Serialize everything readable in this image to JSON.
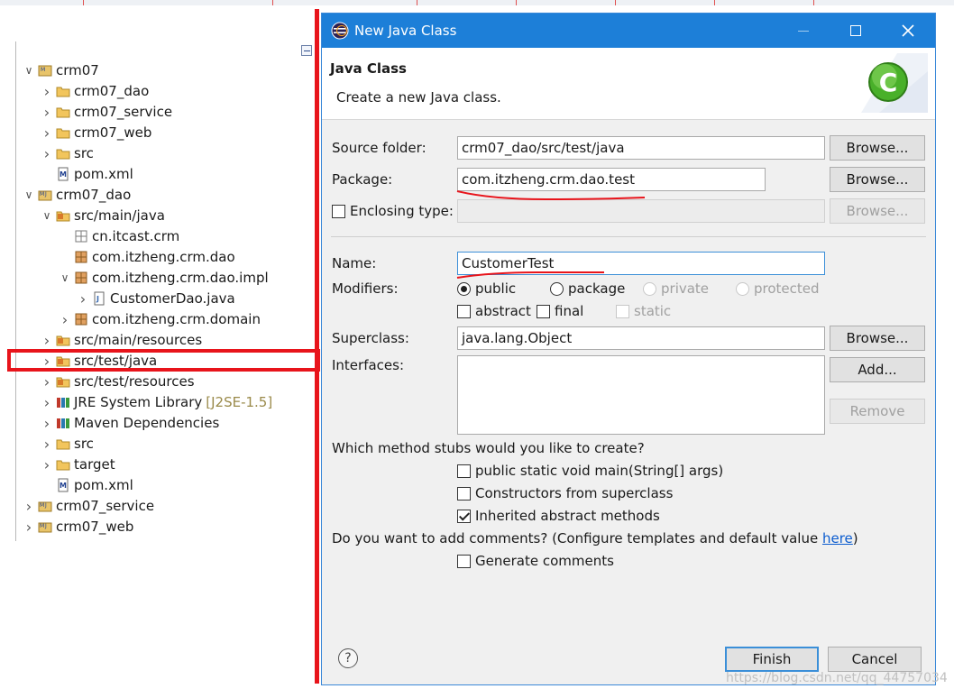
{
  "colors": {
    "titlebar": "#1d7fd8",
    "annotation_red": "#e8141b",
    "focus_blue": "#3b8fd8",
    "link": "#0b5ccf",
    "decoration": "#9a8a4a"
  },
  "explorer": {
    "collapse_icon": "collapse-all-icon",
    "tree": [
      {
        "label": "crm07",
        "icon": "maven-project-icon",
        "level": 0,
        "expanded": true
      },
      {
        "label": "crm07_dao",
        "icon": "folder-icon",
        "level": 1,
        "expanded": false
      },
      {
        "label": "crm07_service",
        "icon": "folder-icon",
        "level": 1,
        "expanded": false
      },
      {
        "label": "crm07_web",
        "icon": "folder-icon",
        "level": 1,
        "expanded": false
      },
      {
        "label": "src",
        "icon": "folder-icon",
        "level": 1,
        "expanded": false
      },
      {
        "label": "pom.xml",
        "icon": "maven-file-icon",
        "level": 1,
        "leaf": true
      },
      {
        "label": "crm07_dao",
        "icon": "maven-java-project-icon",
        "level": 0,
        "expanded": true
      },
      {
        "label": "src/main/java",
        "icon": "source-folder-icon",
        "level": 1,
        "expanded": true
      },
      {
        "label": "cn.itcast.crm",
        "icon": "empty-package-icon",
        "level": 2,
        "leaf": true
      },
      {
        "label": "com.itzheng.crm.dao",
        "icon": "package-icon",
        "level": 2,
        "leaf": true
      },
      {
        "label": "com.itzheng.crm.dao.impl",
        "icon": "package-icon",
        "level": 2,
        "expanded": true
      },
      {
        "label": "CustomerDao.java",
        "icon": "java-file-icon",
        "level": 3,
        "expanded": false
      },
      {
        "label": "com.itzheng.crm.domain",
        "icon": "package-icon",
        "level": 2,
        "expanded": false
      },
      {
        "label": "src/main/resources",
        "icon": "source-folder-icon",
        "level": 1,
        "expanded": false
      },
      {
        "label": "src/test/java",
        "icon": "source-folder-icon",
        "level": 1,
        "expanded": false,
        "selected": true
      },
      {
        "label": "src/test/resources",
        "icon": "source-folder-icon",
        "level": 1,
        "expanded": false
      },
      {
        "label": "JRE System Library",
        "decoration": "[J2SE-1.5]",
        "icon": "library-icon",
        "level": 1,
        "expanded": false
      },
      {
        "label": "Maven Dependencies",
        "icon": "library-icon",
        "level": 1,
        "expanded": false
      },
      {
        "label": "src",
        "icon": "folder-icon",
        "level": 1,
        "expanded": false
      },
      {
        "label": "target",
        "icon": "folder-icon",
        "level": 1,
        "expanded": false
      },
      {
        "label": "pom.xml",
        "icon": "maven-file-icon",
        "level": 1,
        "leaf": true
      },
      {
        "label": "crm07_service",
        "icon": "maven-java-project-icon",
        "level": 0,
        "expanded": false
      },
      {
        "label": "crm07_web",
        "icon": "maven-java-project-icon",
        "level": 0,
        "expanded": false
      }
    ]
  },
  "dialog": {
    "title": "New Java Class",
    "title_icon": "eclipse-icon",
    "window_buttons": {
      "minimize": "minimize-icon",
      "maximize": "maximize-icon",
      "close": "close-icon"
    },
    "header_title": "Java Class",
    "header_desc": "Create a new Java class.",
    "header_icon": "new-class-wizard-icon",
    "source_folder": {
      "label": "Source folder:",
      "value": "crm07_dao/src/test/java",
      "browse": "Browse..."
    },
    "package": {
      "label": "Package:",
      "value": "com.itzheng.crm.dao.test",
      "browse": "Browse..."
    },
    "enclosing": {
      "label": "Enclosing type:",
      "checked": false,
      "value": "",
      "browse": "Browse..."
    },
    "name": {
      "label": "Name:",
      "value": "CustomerTest"
    },
    "modifiers": {
      "label": "Modifiers:",
      "public": "public",
      "package": "package",
      "private": "private",
      "protected": "protected",
      "selected": "public",
      "abstract": "abstract",
      "final": "final",
      "static": "static"
    },
    "superclass": {
      "label": "Superclass:",
      "value": "java.lang.Object",
      "browse": "Browse..."
    },
    "interfaces": {
      "label": "Interfaces:",
      "add": "Add...",
      "remove": "Remove"
    },
    "stubs": {
      "question": "Which method stubs would you like to create?",
      "main": {
        "label": "public static void main(String[] args)",
        "checked": false
      },
      "constructors": {
        "label": "Constructors from superclass",
        "checked": false
      },
      "inherited": {
        "label": "Inherited abstract methods",
        "checked": true
      }
    },
    "comments": {
      "question": "Do you want to add comments? (Configure templates and default value ",
      "link": "here",
      "suffix": ")",
      "generate": {
        "label": "Generate comments",
        "checked": false
      }
    },
    "help_icon": "help-icon",
    "finish": "Finish",
    "cancel": "Cancel"
  },
  "watermark": "https://blog.csdn.net/qq_44757034"
}
